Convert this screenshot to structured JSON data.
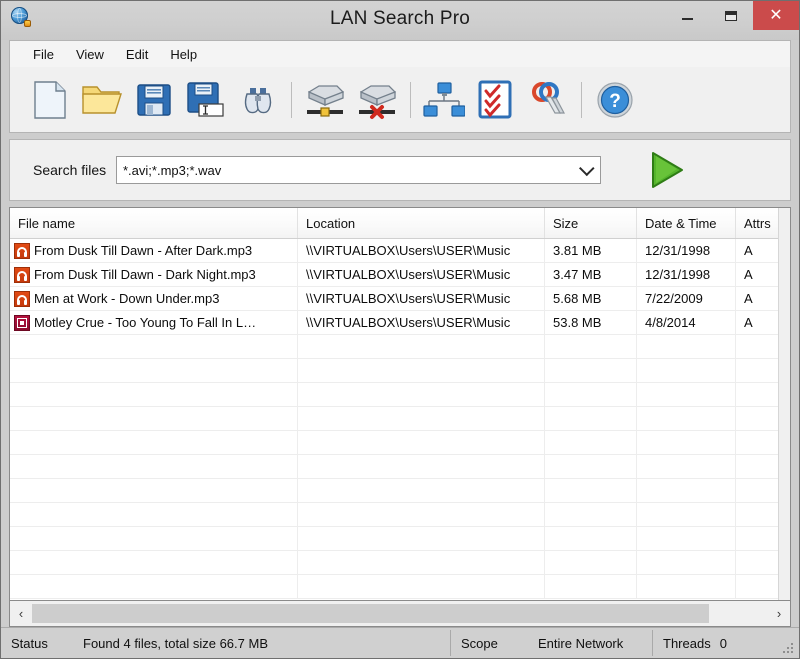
{
  "window": {
    "title": "LAN Search Pro",
    "app_icon": "globe-icon",
    "minimize_label": "–",
    "maximize_label": "□",
    "close_label": "✕"
  },
  "menu": {
    "items": [
      {
        "label": "File"
      },
      {
        "label": "View"
      },
      {
        "label": "Edit"
      },
      {
        "label": "Help"
      }
    ]
  },
  "toolbar": {
    "buttons": [
      {
        "name": "new-document-icon",
        "title": "New"
      },
      {
        "name": "open-folder-icon",
        "title": "Open"
      },
      {
        "name": "save-icon",
        "title": "Save"
      },
      {
        "name": "save-as-icon",
        "title": "Save As"
      },
      {
        "name": "binoculars-icon",
        "title": "Find"
      },
      {
        "name": "add-network-drive-icon",
        "title": "Map Network Drive"
      },
      {
        "name": "remove-network-drive-icon",
        "title": "Disconnect Network Drive"
      },
      {
        "name": "network-computers-icon",
        "title": "Network"
      },
      {
        "name": "checklist-icon",
        "title": "Options"
      },
      {
        "name": "keys-icon",
        "title": "Credentials"
      },
      {
        "name": "help-icon",
        "title": "Help"
      }
    ]
  },
  "search": {
    "label": "Search files",
    "value": "*.avi;*.mp3;*.wav",
    "placeholder": "*.avi;*.mp3;*.wav",
    "dropdown_icon": "chevron-down-icon",
    "start_button": "play-icon"
  },
  "results": {
    "columns": [
      {
        "key": "name",
        "label": "File name"
      },
      {
        "key": "location",
        "label": "Location"
      },
      {
        "key": "size",
        "label": "Size"
      },
      {
        "key": "date",
        "label": "Date & Time"
      },
      {
        "key": "attrs",
        "label": "Attrs"
      }
    ],
    "rows": [
      {
        "icon": "audio",
        "name": "From Dusk Till Dawn - After Dark.mp3",
        "location": "\\\\VIRTUALBOX\\Users\\USER\\Music",
        "size": "3.81 MB",
        "date": "12/31/1998",
        "attrs": "A"
      },
      {
        "icon": "audio",
        "name": "From Dusk Till Dawn - Dark Night.mp3",
        "location": "\\\\VIRTUALBOX\\Users\\USER\\Music",
        "size": "3.47 MB",
        "date": "12/31/1998",
        "attrs": "A"
      },
      {
        "icon": "audio",
        "name": "Men at Work - Down Under.mp3",
        "location": "\\\\VIRTUALBOX\\Users\\USER\\Music",
        "size": "5.68 MB",
        "date": "7/22/2009",
        "attrs": "A"
      },
      {
        "icon": "media",
        "name": "Motley Crue - Too Young To Fall In L…",
        "location": "\\\\VIRTUALBOX\\Users\\USER\\Music",
        "size": "53.8 MB",
        "date": "4/8/2014",
        "attrs": "A"
      }
    ],
    "empty_row_count": 11
  },
  "hscroll": {
    "left_arrow": "‹",
    "right_arrow": "›"
  },
  "statusbar": {
    "status_label": "Status",
    "status_text": "Found 4 files, total size 66.7 MB",
    "scope_label": "Scope",
    "scope_value": "Entire Network",
    "threads_label": "Threads",
    "threads_value": "0"
  },
  "colors": {
    "title_bar": "#cfcfcf",
    "close_button": "#cb4b4b",
    "accent_green": "#4caf2a",
    "audio_icon": "#d3420f",
    "media_icon": "#a30f37",
    "window_frame": "#6f6f6f"
  }
}
